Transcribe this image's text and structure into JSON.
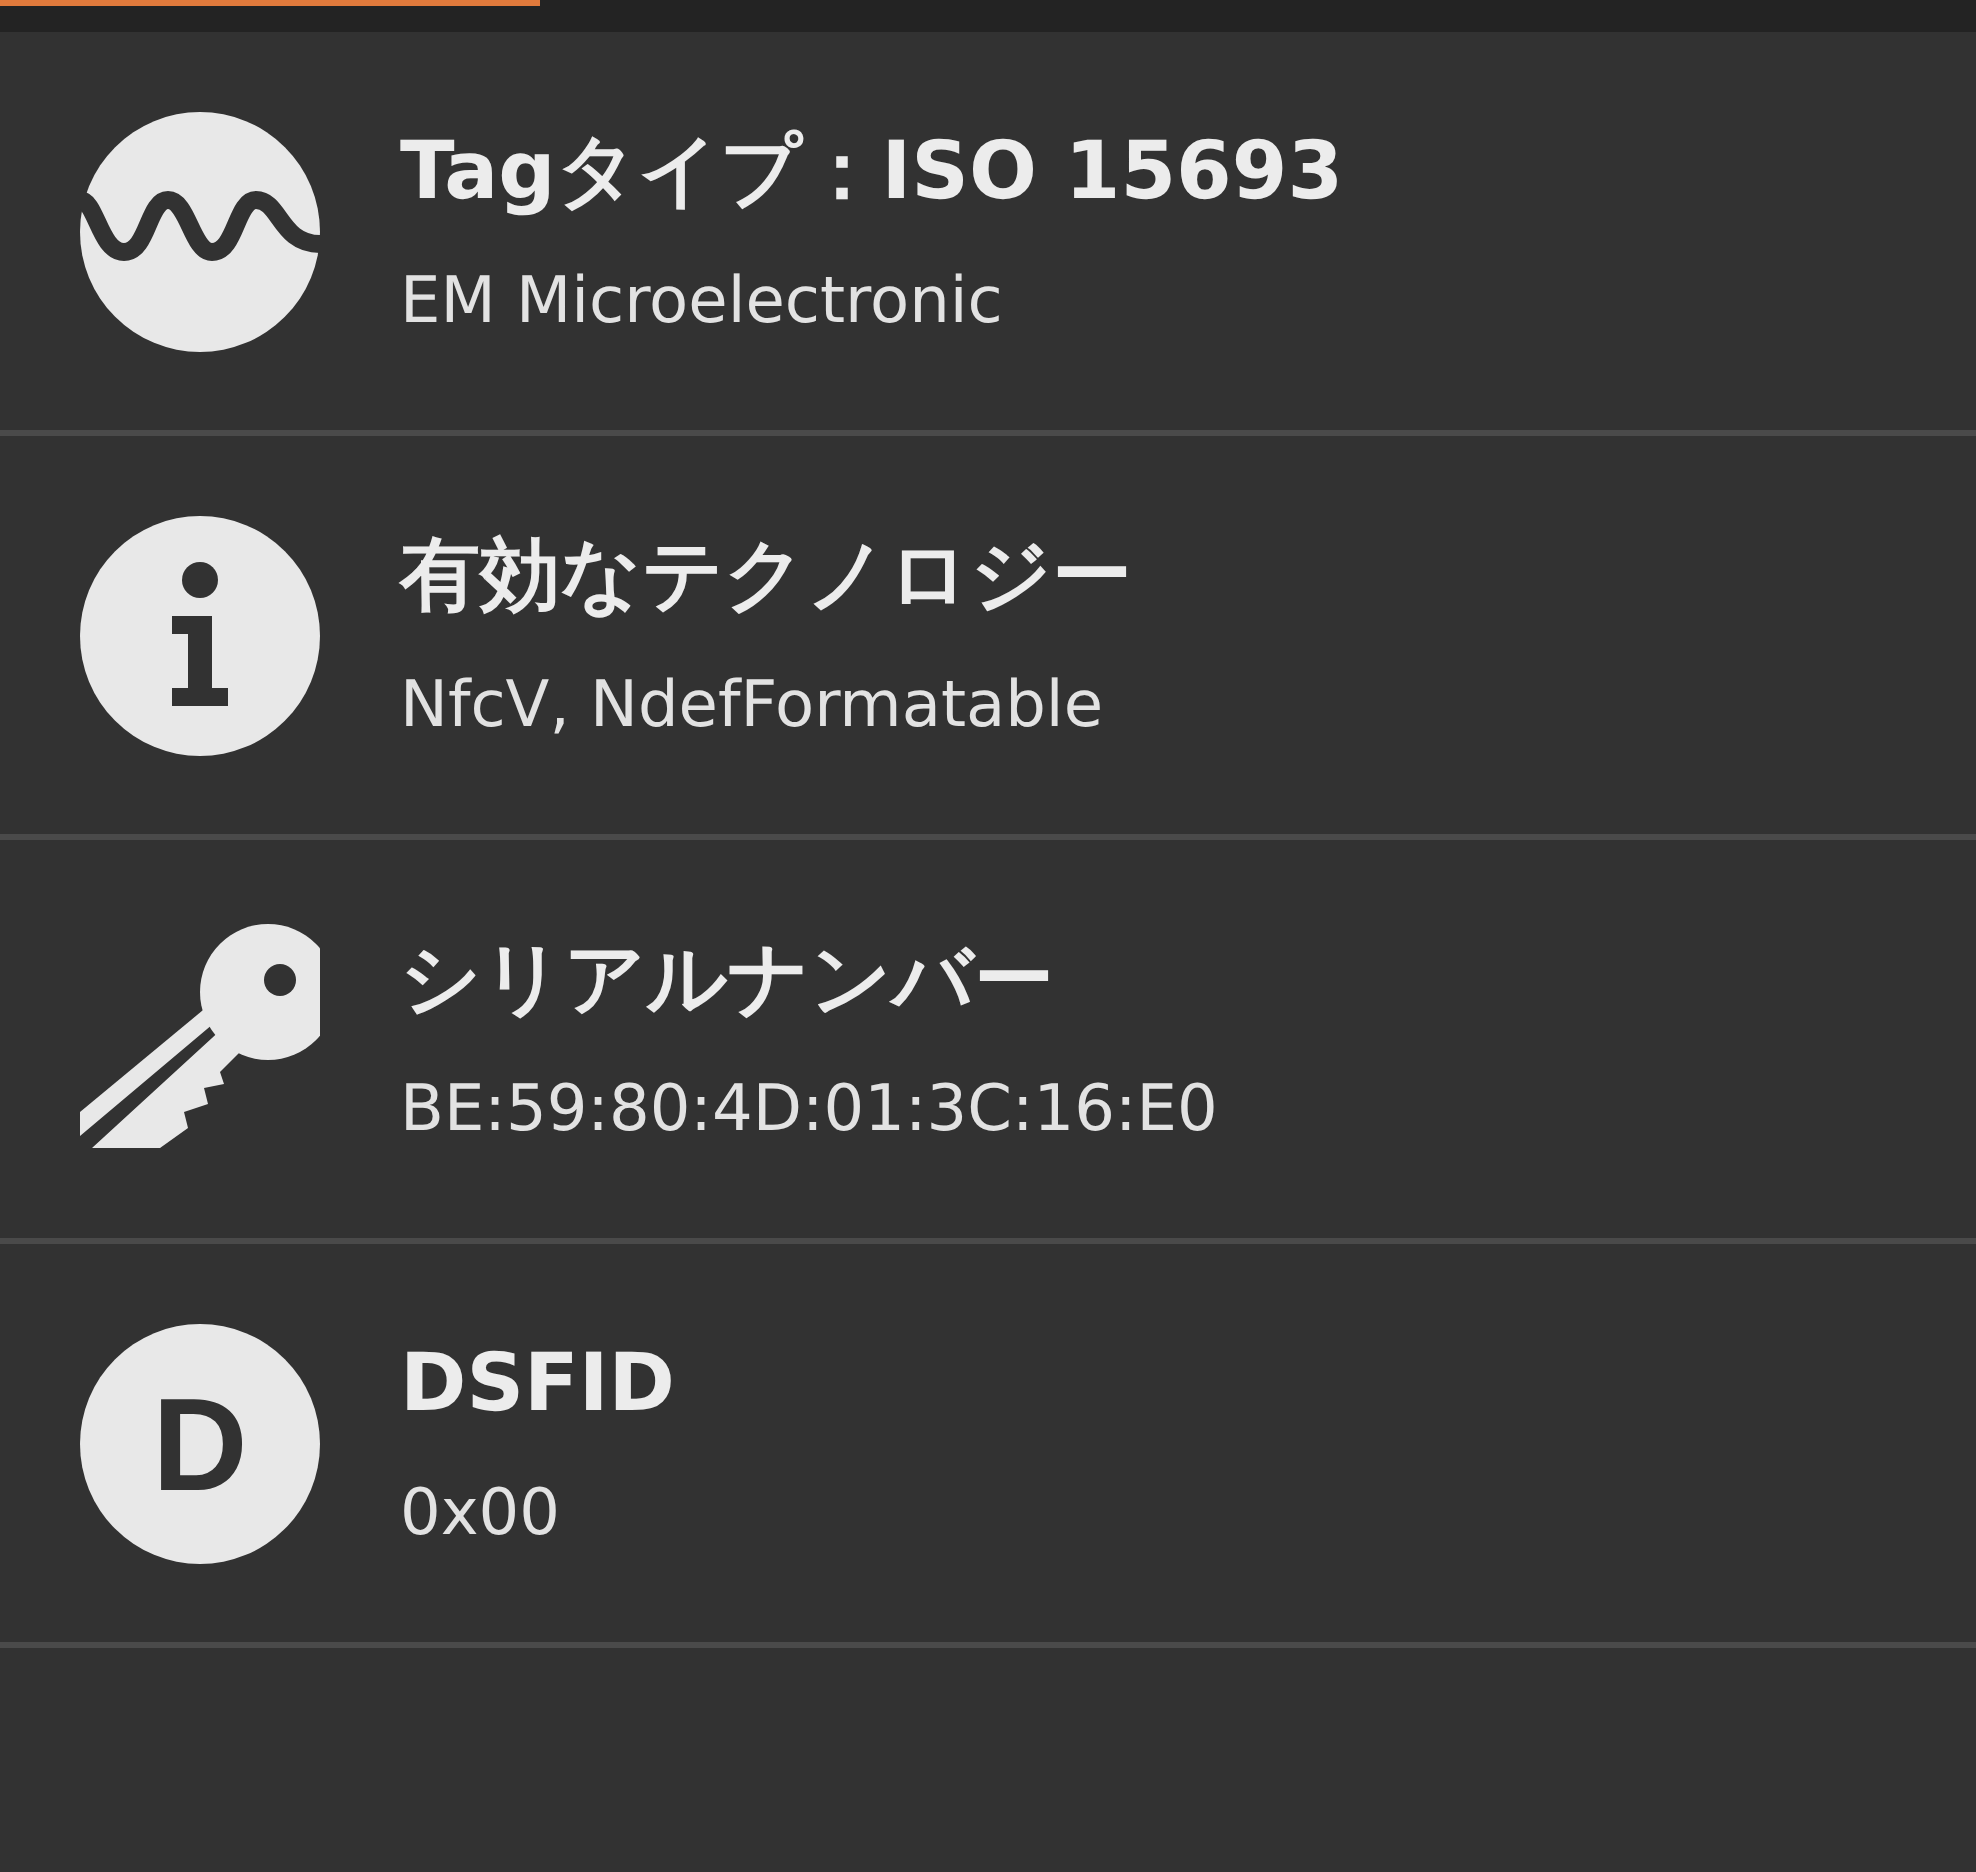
{
  "rows": [
    {
      "icon": {
        "kind": "wave"
      },
      "title": "Tagタイプ：ISO 15693",
      "value": "EM Microelectronic"
    },
    {
      "icon": {
        "kind": "info"
      },
      "title": "有効なテクノロジー",
      "value": "NfcV, NdefFormatable"
    },
    {
      "icon": {
        "kind": "key"
      },
      "title": "シリアルナンバー",
      "value": "BE:59:80:4D:01:3C:16:E0"
    },
    {
      "icon": {
        "kind": "letter",
        "text": "D"
      },
      "title": "DSFID",
      "value": "0x00"
    }
  ]
}
